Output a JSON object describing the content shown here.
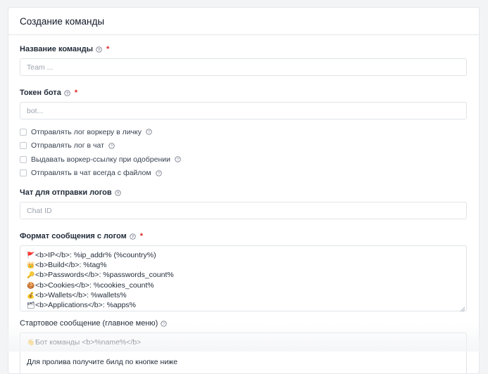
{
  "form": {
    "title": "Создание команды",
    "team_name": {
      "label": "Название команды",
      "placeholder": "Team ..."
    },
    "bot_token": {
      "label": "Токен бота",
      "placeholder": "bot..."
    },
    "checkboxes": [
      {
        "label": "Отправлять лог воркеру в личку",
        "checked": false
      },
      {
        "label": "Отправлять лог в чат",
        "checked": false
      },
      {
        "label": "Выдавать воркер-ссылку при одобрении",
        "checked": false
      },
      {
        "label": "Отправлять в чат всегда с файлом",
        "checked": false
      }
    ],
    "log_chat": {
      "label": "Чат для отправки логов",
      "placeholder": "Chat ID"
    },
    "log_format": {
      "label": "Формат сообщения с логом",
      "lines": [
        {
          "emoji": "🚩",
          "text": "<b>IP</b>: %ip_addr% (%country%)"
        },
        {
          "emoji": "👑",
          "text": "<b>Build</b>: %tag%"
        },
        {
          "emoji": "🔑",
          "text": "<b>Passwords</b>: %passwords_count%"
        },
        {
          "emoji": "🍪",
          "text": "<b>Cookies</b>: %cookies_count%"
        },
        {
          "emoji": "💰",
          "text": "<b>Wallets</b>: %wallets%"
        },
        {
          "emoji": "🗂",
          "text": "<b>Applications</b>: %apps%"
        }
      ]
    },
    "start_message": {
      "label": "Стартовое сообщение (главное меню)",
      "lines": [
        {
          "emoji": "👋",
          "text": "Бот команды <b>%name%</b>"
        },
        {
          "emoji": "",
          "text": ""
        },
        {
          "emoji": "",
          "text": "Для пролива получите билд по кнопке ниже"
        }
      ]
    }
  },
  "colors": {
    "required": "#dc2626",
    "border": "#dfe3e8",
    "background": "#f3f4f6"
  }
}
